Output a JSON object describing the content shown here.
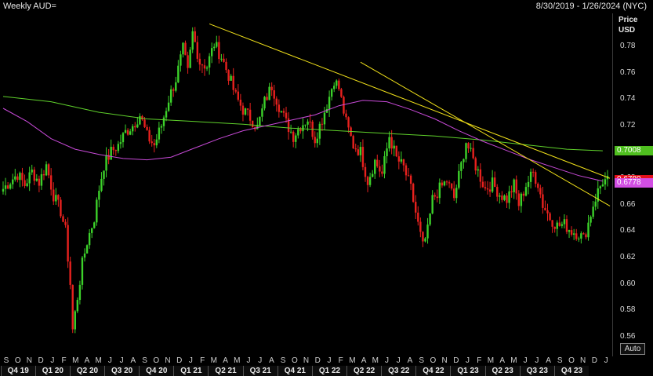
{
  "header": {
    "title": "Weekly AUD=",
    "date_range": "8/30/2019 - 1/26/2024 (NYC)"
  },
  "yaxis": {
    "label_line1": "Price",
    "label_line2": "USD",
    "auto_button": "Auto"
  },
  "badges": [
    {
      "text": "0.7008",
      "value": 0.7008,
      "bg": "#4fbf1f",
      "fg": "#ffffff"
    },
    {
      "text": "0.6780",
      "value": 0.678,
      "bg": "#e3101a",
      "fg": "#ffffff"
    },
    {
      "text": "0.6778",
      "value": 0.6778,
      "bg": "#d24ee3",
      "fg": "#ffffff"
    }
  ],
  "chart_data": {
    "type": "candlestick",
    "ylim": [
      0.545,
      0.805
    ],
    "yticks": [
      "0.78",
      "0.76",
      "0.74",
      "0.72",
      "0.70",
      "0.68",
      "0.66",
      "0.64",
      "0.62",
      "0.60",
      "0.58",
      "0.56"
    ],
    "ytick_values": [
      0.78,
      0.76,
      0.74,
      0.72,
      0.7,
      0.68,
      0.66,
      0.64,
      0.62,
      0.6,
      0.58,
      0.56
    ],
    "month_labels": [
      "S",
      "O",
      "N",
      "D",
      "J",
      "F",
      "M",
      "A",
      "M",
      "J",
      "J",
      "A",
      "S",
      "O",
      "N",
      "D",
      "J",
      "F",
      "M",
      "A",
      "M",
      "J",
      "J",
      "A",
      "S",
      "O",
      "N",
      "D",
      "J",
      "F",
      "M",
      "A",
      "M",
      "J",
      "J",
      "A",
      "S",
      "O",
      "N",
      "D",
      "J",
      "F",
      "M",
      "A",
      "M",
      "J",
      "J",
      "A",
      "S",
      "O",
      "N",
      "D",
      "J"
    ],
    "quarter_labels": [
      "Q4 19",
      "Q1 20",
      "Q2 20",
      "Q3 20",
      "Q4 20",
      "Q1 21",
      "Q2 21",
      "Q3 21",
      "Q4 21",
      "Q1 22",
      "Q2 22",
      "Q3 22",
      "Q4 22",
      "Q1 23",
      "Q2 23",
      "Q3 23",
      "Q4 23"
    ],
    "up_color": "#3cd12a",
    "down_color": "#e8211e",
    "price_path": [
      [
        0,
        0.672
      ],
      [
        3,
        0.678
      ],
      [
        6,
        0.683
      ],
      [
        9,
        0.675
      ],
      [
        12,
        0.685
      ],
      [
        15,
        0.677
      ],
      [
        18,
        0.69
      ],
      [
        21,
        0.667
      ],
      [
        24,
        0.655
      ],
      [
        26,
        0.64
      ],
      [
        28,
        0.6
      ],
      [
        29,
        0.565
      ],
      [
        31,
        0.59
      ],
      [
        33,
        0.615
      ],
      [
        35,
        0.632
      ],
      [
        38,
        0.65
      ],
      [
        40,
        0.672
      ],
      [
        42,
        0.69
      ],
      [
        45,
        0.7
      ],
      [
        48,
        0.705
      ],
      [
        51,
        0.715
      ],
      [
        54,
        0.72
      ],
      [
        57,
        0.728
      ],
      [
        60,
        0.712
      ],
      [
        63,
        0.705
      ],
      [
        66,
        0.72
      ],
      [
        69,
        0.74
      ],
      [
        72,
        0.755
      ],
      [
        75,
        0.778
      ],
      [
        77,
        0.76
      ],
      [
        79,
        0.79
      ],
      [
        82,
        0.768
      ],
      [
        85,
        0.765
      ],
      [
        88,
        0.782
      ],
      [
        91,
        0.772
      ],
      [
        94,
        0.758
      ],
      [
        97,
        0.742
      ],
      [
        100,
        0.732
      ],
      [
        103,
        0.726
      ],
      [
        106,
        0.718
      ],
      [
        109,
        0.738
      ],
      [
        112,
        0.75
      ],
      [
        115,
        0.735
      ],
      [
        118,
        0.722
      ],
      [
        121,
        0.712
      ],
      [
        124,
        0.72
      ],
      [
        127,
        0.725
      ],
      [
        130,
        0.71
      ],
      [
        133,
        0.725
      ],
      [
        136,
        0.742
      ],
      [
        138,
        0.755
      ],
      [
        140,
        0.748
      ],
      [
        143,
        0.722
      ],
      [
        146,
        0.705
      ],
      [
        149,
        0.7
      ],
      [
        152,
        0.678
      ],
      [
        155,
        0.693
      ],
      [
        158,
        0.683
      ],
      [
        161,
        0.712
      ],
      [
        164,
        0.695
      ],
      [
        167,
        0.688
      ],
      [
        170,
        0.672
      ],
      [
        173,
        0.645
      ],
      [
        175,
        0.628
      ],
      [
        177,
        0.64
      ],
      [
        179,
        0.664
      ],
      [
        182,
        0.672
      ],
      [
        185,
        0.678
      ],
      [
        188,
        0.665
      ],
      [
        191,
        0.69
      ],
      [
        193,
        0.708
      ],
      [
        195,
        0.698
      ],
      [
        198,
        0.685
      ],
      [
        201,
        0.672
      ],
      [
        204,
        0.676
      ],
      [
        207,
        0.668
      ],
      [
        210,
        0.664
      ],
      [
        213,
        0.675
      ],
      [
        215,
        0.66
      ],
      [
        218,
        0.675
      ],
      [
        221,
        0.684
      ],
      [
        223,
        0.676
      ],
      [
        225,
        0.66
      ],
      [
        228,
        0.65
      ],
      [
        231,
        0.644
      ],
      [
        234,
        0.645
      ],
      [
        237,
        0.64
      ],
      [
        240,
        0.638
      ],
      [
        242,
        0.634
      ],
      [
        244,
        0.646
      ],
      [
        246,
        0.66
      ],
      [
        248,
        0.67
      ],
      [
        250,
        0.678
      ]
    ],
    "ma_green": [
      [
        0,
        0.742
      ],
      [
        20,
        0.738
      ],
      [
        40,
        0.73
      ],
      [
        60,
        0.725
      ],
      [
        80,
        0.723
      ],
      [
        100,
        0.721
      ],
      [
        120,
        0.718
      ],
      [
        140,
        0.716
      ],
      [
        160,
        0.714
      ],
      [
        180,
        0.712
      ],
      [
        200,
        0.709
      ],
      [
        220,
        0.705
      ],
      [
        235,
        0.702
      ],
      [
        250,
        0.7008
      ]
    ],
    "ma_magenta": [
      [
        0,
        0.733
      ],
      [
        10,
        0.723
      ],
      [
        20,
        0.71
      ],
      [
        30,
        0.702
      ],
      [
        40,
        0.698
      ],
      [
        50,
        0.695
      ],
      [
        60,
        0.694
      ],
      [
        70,
        0.696
      ],
      [
        80,
        0.703
      ],
      [
        90,
        0.71
      ],
      [
        100,
        0.716
      ],
      [
        110,
        0.72
      ],
      [
        120,
        0.724
      ],
      [
        130,
        0.728
      ],
      [
        140,
        0.735
      ],
      [
        150,
        0.739
      ],
      [
        160,
        0.738
      ],
      [
        170,
        0.732
      ],
      [
        180,
        0.725
      ],
      [
        190,
        0.716
      ],
      [
        200,
        0.708
      ],
      [
        210,
        0.701
      ],
      [
        220,
        0.694
      ],
      [
        230,
        0.688
      ],
      [
        240,
        0.682
      ],
      [
        250,
        0.6778
      ]
    ],
    "trendlines": [
      {
        "x1": 86,
        "y1": 0.797,
        "x2": 253,
        "y2": 0.68
      },
      {
        "x1": 149,
        "y1": 0.768,
        "x2": 253,
        "y2": 0.659
      }
    ],
    "n_weeks": 253
  }
}
